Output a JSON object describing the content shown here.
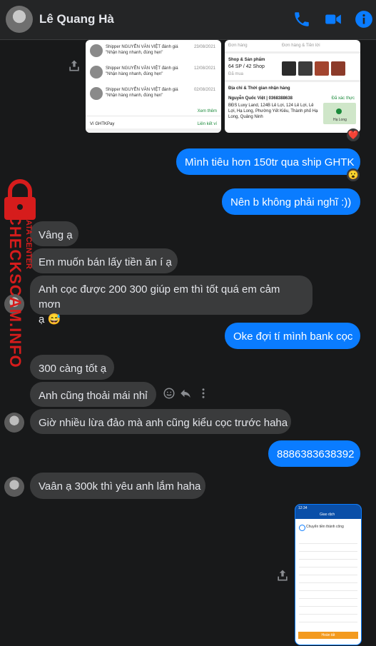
{
  "header": {
    "contact_name": "Lê Quang Hà"
  },
  "watermark": {
    "brand": "CHECKSCAM.INFO",
    "subtitle": "DATA CENTER"
  },
  "shared_card": {
    "reviews": [
      {
        "text": "Shipper NGUYỄN VĂN VIỆT đánh giá",
        "quote": "\"Nhận hàng nhanh, đúng hẹn\"",
        "date": "23/08/2021"
      },
      {
        "text": "Shipper NGUYỄN VĂN VIỆT đánh giá",
        "quote": "\"Nhận hàng nhanh, đúng hẹn\"",
        "date": "12/08/2021"
      },
      {
        "text": "Shipper NGUYỄN VĂN VIỆT đánh giá",
        "quote": "\"Nhận hàng nhanh, đúng hẹn\"",
        "date": "02/08/2021"
      }
    ],
    "see_more": "Xem thêm",
    "wallet": "Ví GHTKPay",
    "wallet_link": "Liên kết ví",
    "tabs": [
      "Đơn hàng",
      "Đơn hàng & Tiền lời"
    ],
    "shop_label": "Shop & Sản phẩm",
    "shop_count": "64 SP / 42 Shop",
    "shop_sub": "Đã mua",
    "addr_label": "Địa chỉ & Thời gian nhận hàng",
    "addr_name": "Nguyễn Quốc Việt | 0368388638",
    "addr_link": "Đã xác thực",
    "addr_text": "BĐS Luxy Land, 124B Lê Lợi, 124 Lê Lợi, Lê Lợi, Hạ Long, Phường Yết Kiêu, Thành phố Hạ Long, Quảng Ninh",
    "map_label": "Hạ Long"
  },
  "messages": [
    {
      "text": "Mình tiêu hơn 150tr qua ship GHTK",
      "reaction": "😮"
    },
    {
      "text": "Nên b không phải nghĩ :))"
    },
    {
      "text": "Vâng ạ"
    },
    {
      "text": "Em muốn bán lấy tiền ăn í ạ"
    },
    {
      "text": "Anh cọc được 200 300 giúp em thì tốt quá em cảm mơn"
    },
    {
      "text": "ạ 😅"
    },
    {
      "text": "Oke đợi tí mình bank cọc"
    },
    {
      "text": "300 càng tốt ạ"
    },
    {
      "text": "Anh cũng thoải mái nhỉ"
    },
    {
      "text": "Giờ nhiều lừa đảo mà anh cũng kiểu cọc trước haha"
    },
    {
      "text": "8886383638392"
    },
    {
      "text": "Vaân ạ 300k thì yêu anh lắm haha"
    }
  ],
  "image_reaction": "❤️",
  "receipt": {
    "status_time": "12:34",
    "title": "Giao dịch",
    "success": "Chuyển tiền thành công",
    "button": "Hoàn tất"
  },
  "colors": {
    "accent": "#0a7cff",
    "incoming": "#3a3b3c",
    "background": "#18191a",
    "watermark": "#d61c1c"
  }
}
